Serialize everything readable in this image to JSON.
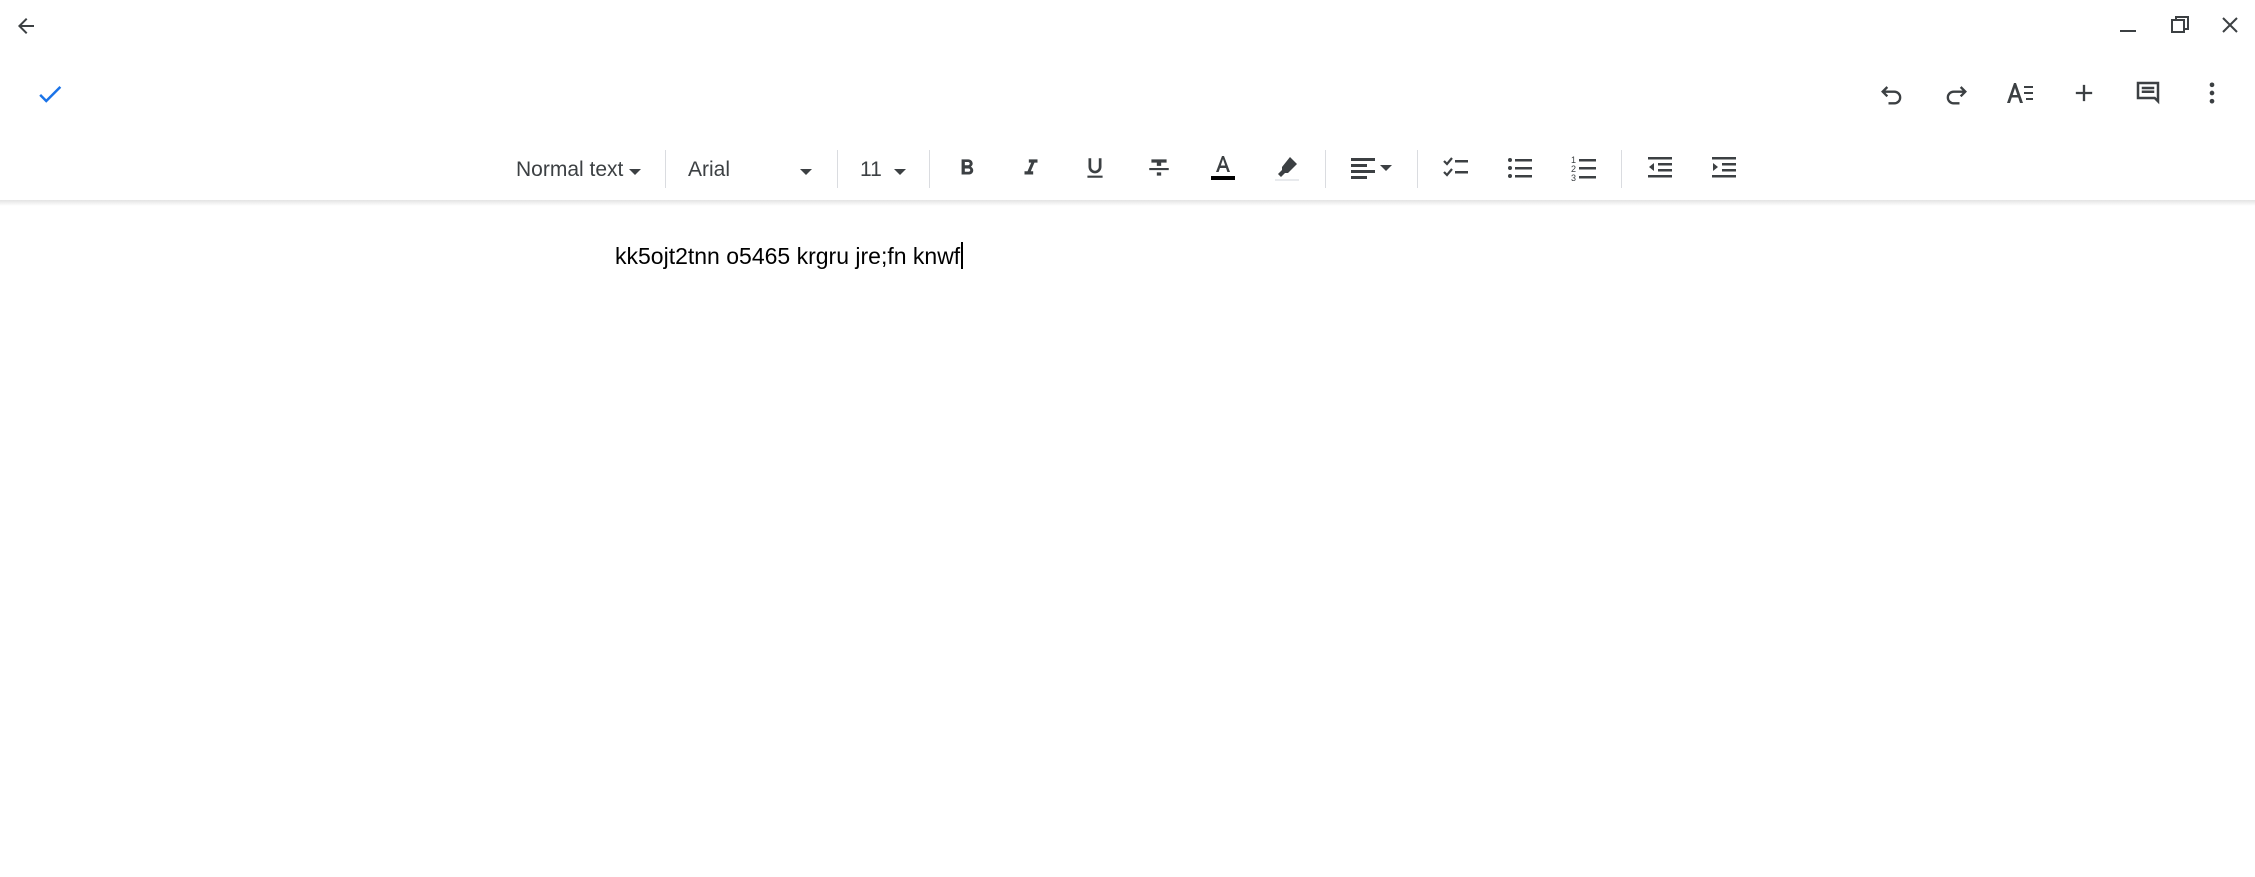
{
  "titlebar": {
    "back_icon": "arrow-left-icon",
    "window_controls": [
      "minimize-icon",
      "restore-icon",
      "close-icon"
    ]
  },
  "appbar": {
    "done_icon": "check-icon",
    "actions": [
      "undo-icon",
      "redo-icon",
      "text-format-icon",
      "plus-icon",
      "comment-icon",
      "more-vert-icon"
    ],
    "accent_color": "#1a73e8"
  },
  "toolbar": {
    "style_select": "Normal text",
    "font_select": "Arial",
    "size_select": "11",
    "text_color": "#000000",
    "buttons": [
      "bold-icon",
      "italic-icon",
      "underline-icon",
      "strikethrough-icon",
      "text-color-icon",
      "highlight-icon",
      "align-icon",
      "checklist-icon",
      "bulleted-list-icon",
      "numbered-list-icon",
      "decrease-indent-icon",
      "increase-indent-icon"
    ]
  },
  "document": {
    "text": "kk5ojt2tnn o5465 krgru jre;fn knwf"
  }
}
